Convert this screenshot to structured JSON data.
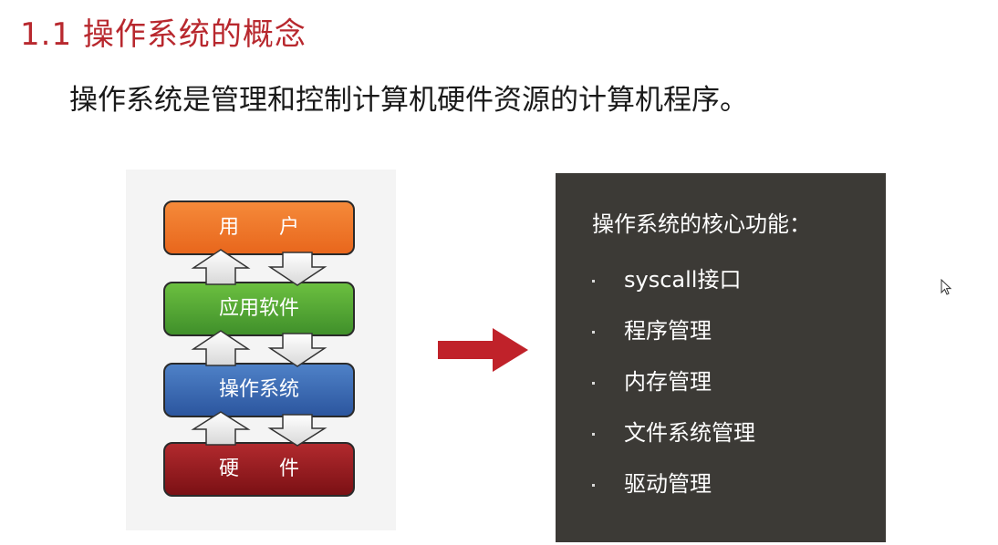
{
  "slide": {
    "title": "1.1 操作系统的概念",
    "lead": "操作系统是管理和控制计算机硬件资源的计算机程序。"
  },
  "diagram": {
    "layers": [
      {
        "label": "用　　户",
        "color": "#f07a2e"
      },
      {
        "label": "应用软件",
        "color": "#5aa93a"
      },
      {
        "label": "操作系统",
        "color": "#3d6eb8"
      },
      {
        "label": "硬　　件",
        "color": "#9b1c20"
      }
    ]
  },
  "arrow": {
    "color": "#c0222a"
  },
  "functions": {
    "title": "操作系统的核心功能：",
    "items": [
      "syscall接口",
      "程序管理",
      "内存管理",
      "文件系统管理",
      "驱动管理"
    ]
  }
}
